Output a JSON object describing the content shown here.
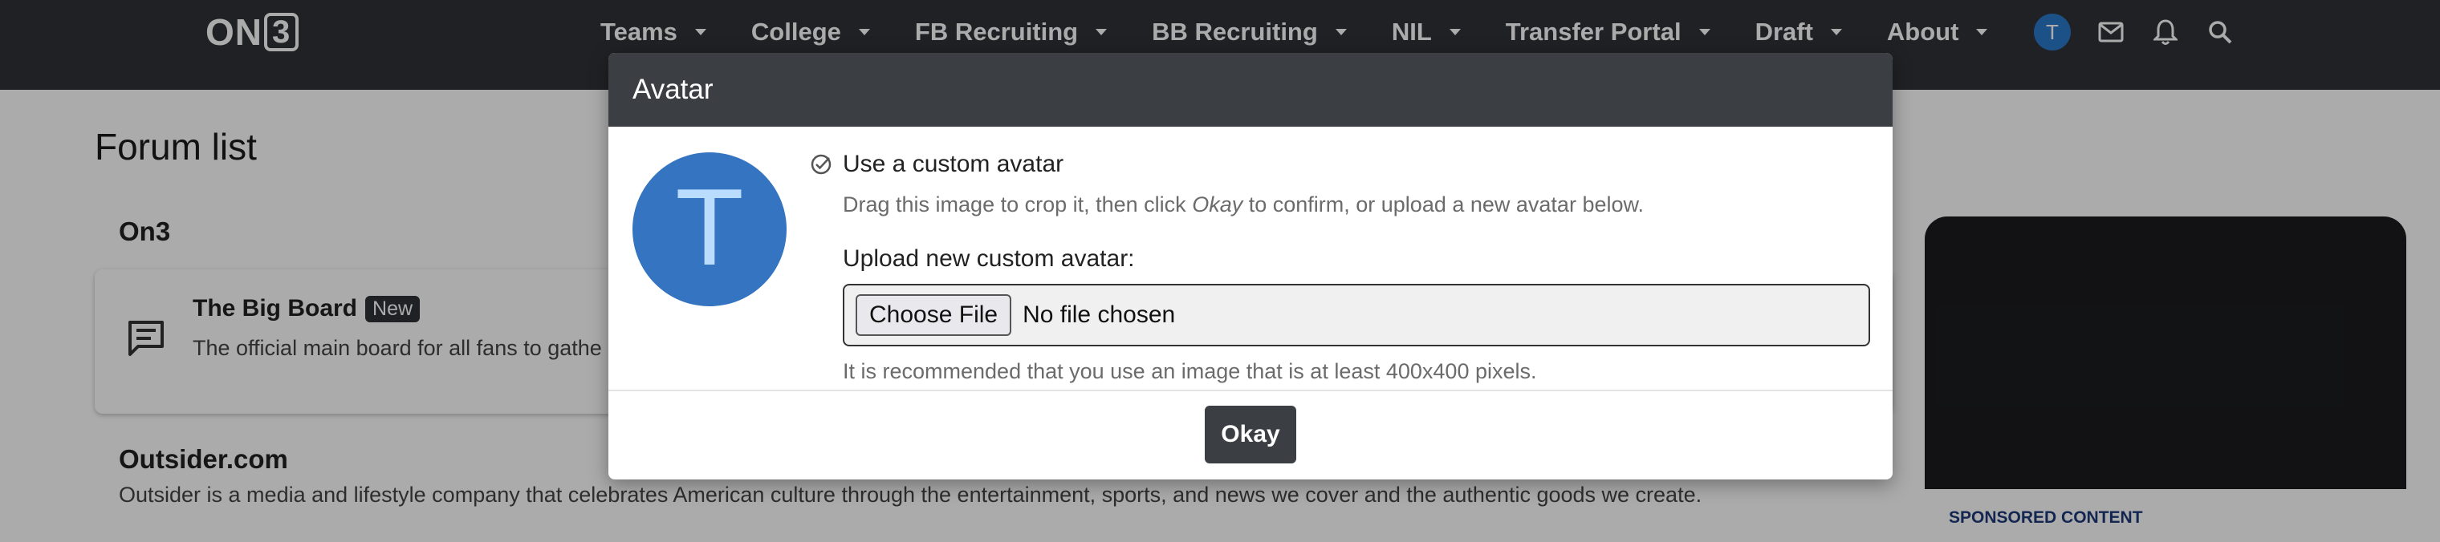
{
  "nav": {
    "logo": "ON",
    "logo_digit": "3",
    "items": [
      {
        "label": "Teams"
      },
      {
        "label": "College"
      },
      {
        "label": "FB Recruiting"
      },
      {
        "label": "BB Recruiting"
      },
      {
        "label": "NIL"
      },
      {
        "label": "Transfer Portal"
      },
      {
        "label": "Draft"
      },
      {
        "label": "About"
      }
    ],
    "user_initial": "T",
    "icons": [
      "mail-icon",
      "bell-icon",
      "search-icon"
    ]
  },
  "page": {
    "title": "Forum list",
    "sections": [
      {
        "title": "On3"
      },
      {
        "title": "Outsider.com",
        "description": "Outsider is a media and lifestyle company that celebrates American culture through the entertainment, sports, and news we cover and the authentic goods we create."
      }
    ],
    "big_board": {
      "title": "The Big Board",
      "badge": "New",
      "description": "The official main board for all fans to gathe post."
    }
  },
  "ad": {
    "label": "SPONSORED CONTENT"
  },
  "modal": {
    "title": "Avatar",
    "avatar_initial": "T",
    "option_label": "Use a custom avatar",
    "hint_prefix": "Drag this image to crop it, then click ",
    "hint_em": "Okay",
    "hint_suffix": " to confirm, or upload a new avatar below.",
    "upload_label": "Upload new custom avatar:",
    "choose_file": "Choose File",
    "no_file": "No file chosen",
    "recommendation": "It is recommended that you use an image that is at least 400x400 pixels.",
    "okay_button": "Okay"
  },
  "colors": {
    "nav_bg": "#2f3236",
    "avatar_blue": "#3474c0",
    "sponsored_blue": "#1d3a7a"
  }
}
